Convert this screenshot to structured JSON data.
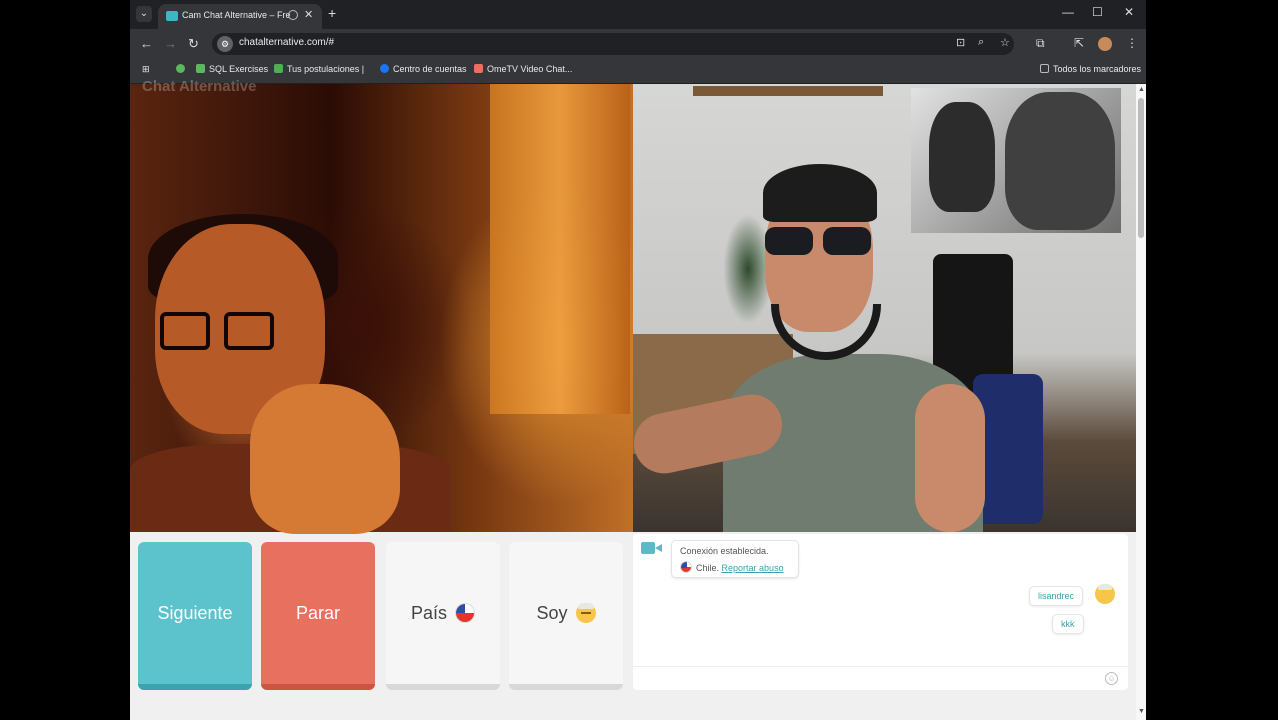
{
  "browser": {
    "tab_title": "Cam Chat Alternative – Fre",
    "url": "chatalternative.com/#",
    "bookmarks": [
      {
        "label": "SQL Exercises",
        "color": "#5cb85c"
      },
      {
        "label": "Tus postulaciones |",
        "color": "#4caf50"
      },
      {
        "label": "Centro de cuentas",
        "color": "#1877f2"
      },
      {
        "label": "OmeTV Video Chat...",
        "color": "#e8705e"
      }
    ],
    "all_bookmarks": "Todos los marcadores"
  },
  "page": {
    "logo_text": "Chat Alternative"
  },
  "controls": {
    "next_label": "Siguiente",
    "stop_label": "Parar",
    "country_label": "País",
    "gender_label": "Soy"
  },
  "chat": {
    "system_line1": "Conexión establecida.",
    "system_country": "Chile.",
    "system_report": "Reportar abuso",
    "messages": [
      "lisandrec",
      "kkk"
    ]
  },
  "colors": {
    "next": "#5cc3cd",
    "stop": "#e8705e",
    "accent": "#3aa3ad"
  }
}
